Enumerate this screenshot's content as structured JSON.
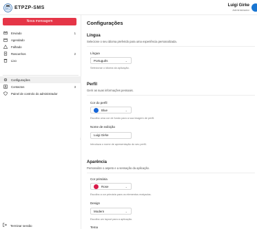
{
  "header": {
    "app_title": "ETPZP-SMS",
    "user_name": "Luigi Girke",
    "user_role": "Administrador"
  },
  "sidebar": {
    "new_message_label": "Nova mensagem",
    "items": [
      {
        "label": "Enviado",
        "count": "1",
        "icon": "send-icon"
      },
      {
        "label": "Agendado",
        "count": "",
        "icon": "calendar-icon"
      },
      {
        "label": "Falhado",
        "count": "",
        "icon": "warning-icon"
      },
      {
        "label": "Rascunhos",
        "count": "2",
        "icon": "draft-icon"
      },
      {
        "label": "Lixo",
        "count": "",
        "icon": "trash-icon"
      },
      {
        "label": "Configurações",
        "count": "",
        "icon": "gear-icon"
      },
      {
        "label": "Contactos",
        "count": "3",
        "icon": "contacts-icon"
      },
      {
        "label": "Painel de controlo do administrador",
        "count": "",
        "icon": "shield-icon"
      }
    ],
    "logout_label": "Terminar sessão"
  },
  "main": {
    "title": "Configurações",
    "language": {
      "title": "Língua",
      "description": "Selecione o seu idioma preferido para uma experiência personalizada.",
      "field_label": "Língua",
      "value": "Português",
      "help": "Selecionar o idioma da aplicação."
    },
    "profile": {
      "title": "Perfil",
      "description": "Gerir as suas informações pessoais.",
      "color_label": "Cor do perfil",
      "color_value": "Blue",
      "color_hex": "#1565d8",
      "color_help": "Escolha uma cor de fundo para a sua imagem de perfil.",
      "display_name_label": "Nome de exibição",
      "display_name_value": "Luigi Girke",
      "display_name_help": "Introduza o nome de apresentação do seu perfil."
    },
    "appearance": {
      "title": "Aparência",
      "description": "Personalize o aspeto e a sensação da aplicação.",
      "primary_label": "Cor primária",
      "primary_value": "Rose",
      "primary_hex": "#d81b4a",
      "primary_help": "Escolha a cor primária para os elementos realçados.",
      "design_label": "Design",
      "design_value": "Modern",
      "design_help": "Escolha um layout para a aplicação.",
      "theme_label": "Tema"
    }
  }
}
